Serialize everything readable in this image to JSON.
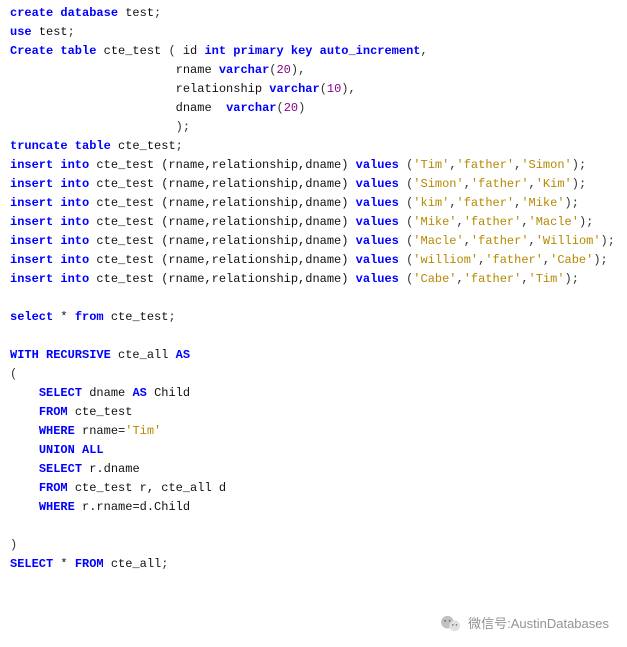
{
  "language": "sql",
  "watermark": {
    "label": "微信号",
    "value": "AustinDatabases"
  },
  "code_lines": [
    [
      [
        "kw",
        "create database "
      ],
      [
        "id",
        "test"
      ],
      [
        "pn",
        ";"
      ]
    ],
    [
      [
        "kw",
        "use "
      ],
      [
        "id",
        "test"
      ],
      [
        "pn",
        ";"
      ]
    ],
    [
      [
        "kw",
        "Create table "
      ],
      [
        "id",
        "cte_test "
      ],
      [
        "pn",
        "( "
      ],
      [
        "id",
        "id "
      ],
      [
        "ty",
        "int primary key auto_increment"
      ],
      [
        "pn",
        ","
      ]
    ],
    [
      [
        "pn",
        "                       "
      ],
      [
        "id",
        "rname "
      ],
      [
        "ty",
        "varchar"
      ],
      [
        "pn",
        "("
      ],
      [
        "num",
        "20"
      ],
      [
        "pn",
        "),"
      ]
    ],
    [
      [
        "pn",
        "                       "
      ],
      [
        "id",
        "relationship "
      ],
      [
        "ty",
        "varchar"
      ],
      [
        "pn",
        "("
      ],
      [
        "num",
        "10"
      ],
      [
        "pn",
        "),"
      ]
    ],
    [
      [
        "pn",
        "                       "
      ],
      [
        "id",
        "dname  "
      ],
      [
        "ty",
        "varchar"
      ],
      [
        "pn",
        "("
      ],
      [
        "num",
        "20"
      ],
      [
        "pn",
        ")"
      ]
    ],
    [
      [
        "pn",
        "                       );"
      ]
    ],
    [
      [
        "kw",
        "truncate table "
      ],
      [
        "id",
        "cte_test"
      ],
      [
        "pn",
        ";"
      ]
    ],
    [
      [
        "kw",
        "insert into "
      ],
      [
        "id",
        "cte_test (rname,relationship,dname) "
      ],
      [
        "kw",
        "values "
      ],
      [
        "pn",
        "("
      ],
      [
        "str",
        "'Tim'"
      ],
      [
        "pn",
        ","
      ],
      [
        "str",
        "'father'"
      ],
      [
        "pn",
        ","
      ],
      [
        "str",
        "'Simon'"
      ],
      [
        "pn",
        ");"
      ]
    ],
    [
      [
        "kw",
        "insert into "
      ],
      [
        "id",
        "cte_test (rname,relationship,dname) "
      ],
      [
        "kw",
        "values "
      ],
      [
        "pn",
        "("
      ],
      [
        "str",
        "'Simon'"
      ],
      [
        "pn",
        ","
      ],
      [
        "str",
        "'father'"
      ],
      [
        "pn",
        ","
      ],
      [
        "str",
        "'Kim'"
      ],
      [
        "pn",
        ");"
      ]
    ],
    [
      [
        "kw",
        "insert into "
      ],
      [
        "id",
        "cte_test (rname,relationship,dname) "
      ],
      [
        "kw",
        "values "
      ],
      [
        "pn",
        "("
      ],
      [
        "str",
        "'kim'"
      ],
      [
        "pn",
        ","
      ],
      [
        "str",
        "'father'"
      ],
      [
        "pn",
        ","
      ],
      [
        "str",
        "'Mike'"
      ],
      [
        "pn",
        ");"
      ]
    ],
    [
      [
        "kw",
        "insert into "
      ],
      [
        "id",
        "cte_test (rname,relationship,dname) "
      ],
      [
        "kw",
        "values "
      ],
      [
        "pn",
        "("
      ],
      [
        "str",
        "'Mike'"
      ],
      [
        "pn",
        ","
      ],
      [
        "str",
        "'father'"
      ],
      [
        "pn",
        ","
      ],
      [
        "str",
        "'Macle'"
      ],
      [
        "pn",
        ");"
      ]
    ],
    [
      [
        "kw",
        "insert into "
      ],
      [
        "id",
        "cte_test (rname,relationship,dname) "
      ],
      [
        "kw",
        "values "
      ],
      [
        "pn",
        "("
      ],
      [
        "str",
        "'Macle'"
      ],
      [
        "pn",
        ","
      ],
      [
        "str",
        "'father'"
      ],
      [
        "pn",
        ","
      ],
      [
        "str",
        "'Williom'"
      ],
      [
        "pn",
        ");"
      ]
    ],
    [
      [
        "kw",
        "insert into "
      ],
      [
        "id",
        "cte_test (rname,relationship,dname) "
      ],
      [
        "kw",
        "values "
      ],
      [
        "pn",
        "("
      ],
      [
        "str",
        "'williom'"
      ],
      [
        "pn",
        ","
      ],
      [
        "str",
        "'father'"
      ],
      [
        "pn",
        ","
      ],
      [
        "str",
        "'Cabe'"
      ],
      [
        "pn",
        ");"
      ]
    ],
    [
      [
        "kw",
        "insert into "
      ],
      [
        "id",
        "cte_test (rname,relationship,dname) "
      ],
      [
        "kw",
        "values "
      ],
      [
        "pn",
        "("
      ],
      [
        "str",
        "'Cabe'"
      ],
      [
        "pn",
        ","
      ],
      [
        "str",
        "'father'"
      ],
      [
        "pn",
        ","
      ],
      [
        "str",
        "'Tim'"
      ],
      [
        "pn",
        ");"
      ]
    ],
    [],
    [
      [
        "kw",
        "select"
      ],
      [
        "id",
        " * "
      ],
      [
        "kw",
        "from "
      ],
      [
        "id",
        "cte_test"
      ],
      [
        "pn",
        ";"
      ]
    ],
    [],
    [
      [
        "kw",
        "WITH RECURSIVE "
      ],
      [
        "id",
        "cte_all "
      ],
      [
        "kw",
        "AS"
      ]
    ],
    [
      [
        "pn",
        "("
      ]
    ],
    [
      [
        "pn",
        "    "
      ],
      [
        "kw",
        "SELECT "
      ],
      [
        "id",
        "dname "
      ],
      [
        "kw",
        "AS "
      ],
      [
        "id",
        "Child"
      ]
    ],
    [
      [
        "pn",
        "    "
      ],
      [
        "kw",
        "FROM "
      ],
      [
        "id",
        "cte_test"
      ]
    ],
    [
      [
        "pn",
        "    "
      ],
      [
        "kw",
        "WHERE "
      ],
      [
        "id",
        "rname="
      ],
      [
        "str",
        "'Tim'"
      ]
    ],
    [
      [
        "pn",
        "    "
      ],
      [
        "kw",
        "UNION ALL"
      ]
    ],
    [
      [
        "pn",
        "    "
      ],
      [
        "kw",
        "SELECT "
      ],
      [
        "id",
        "r.dname"
      ]
    ],
    [
      [
        "pn",
        "    "
      ],
      [
        "kw",
        "FROM "
      ],
      [
        "id",
        "cte_test r, cte_all d"
      ]
    ],
    [
      [
        "pn",
        "    "
      ],
      [
        "kw",
        "WHERE "
      ],
      [
        "id",
        "r.rname=d.Child"
      ]
    ],
    [],
    [
      [
        "pn",
        ")"
      ]
    ],
    [
      [
        "kw",
        "SELECT"
      ],
      [
        "id",
        " * "
      ],
      [
        "kw",
        "FROM "
      ],
      [
        "id",
        "cte_all"
      ],
      [
        "pn",
        ";"
      ]
    ]
  ]
}
